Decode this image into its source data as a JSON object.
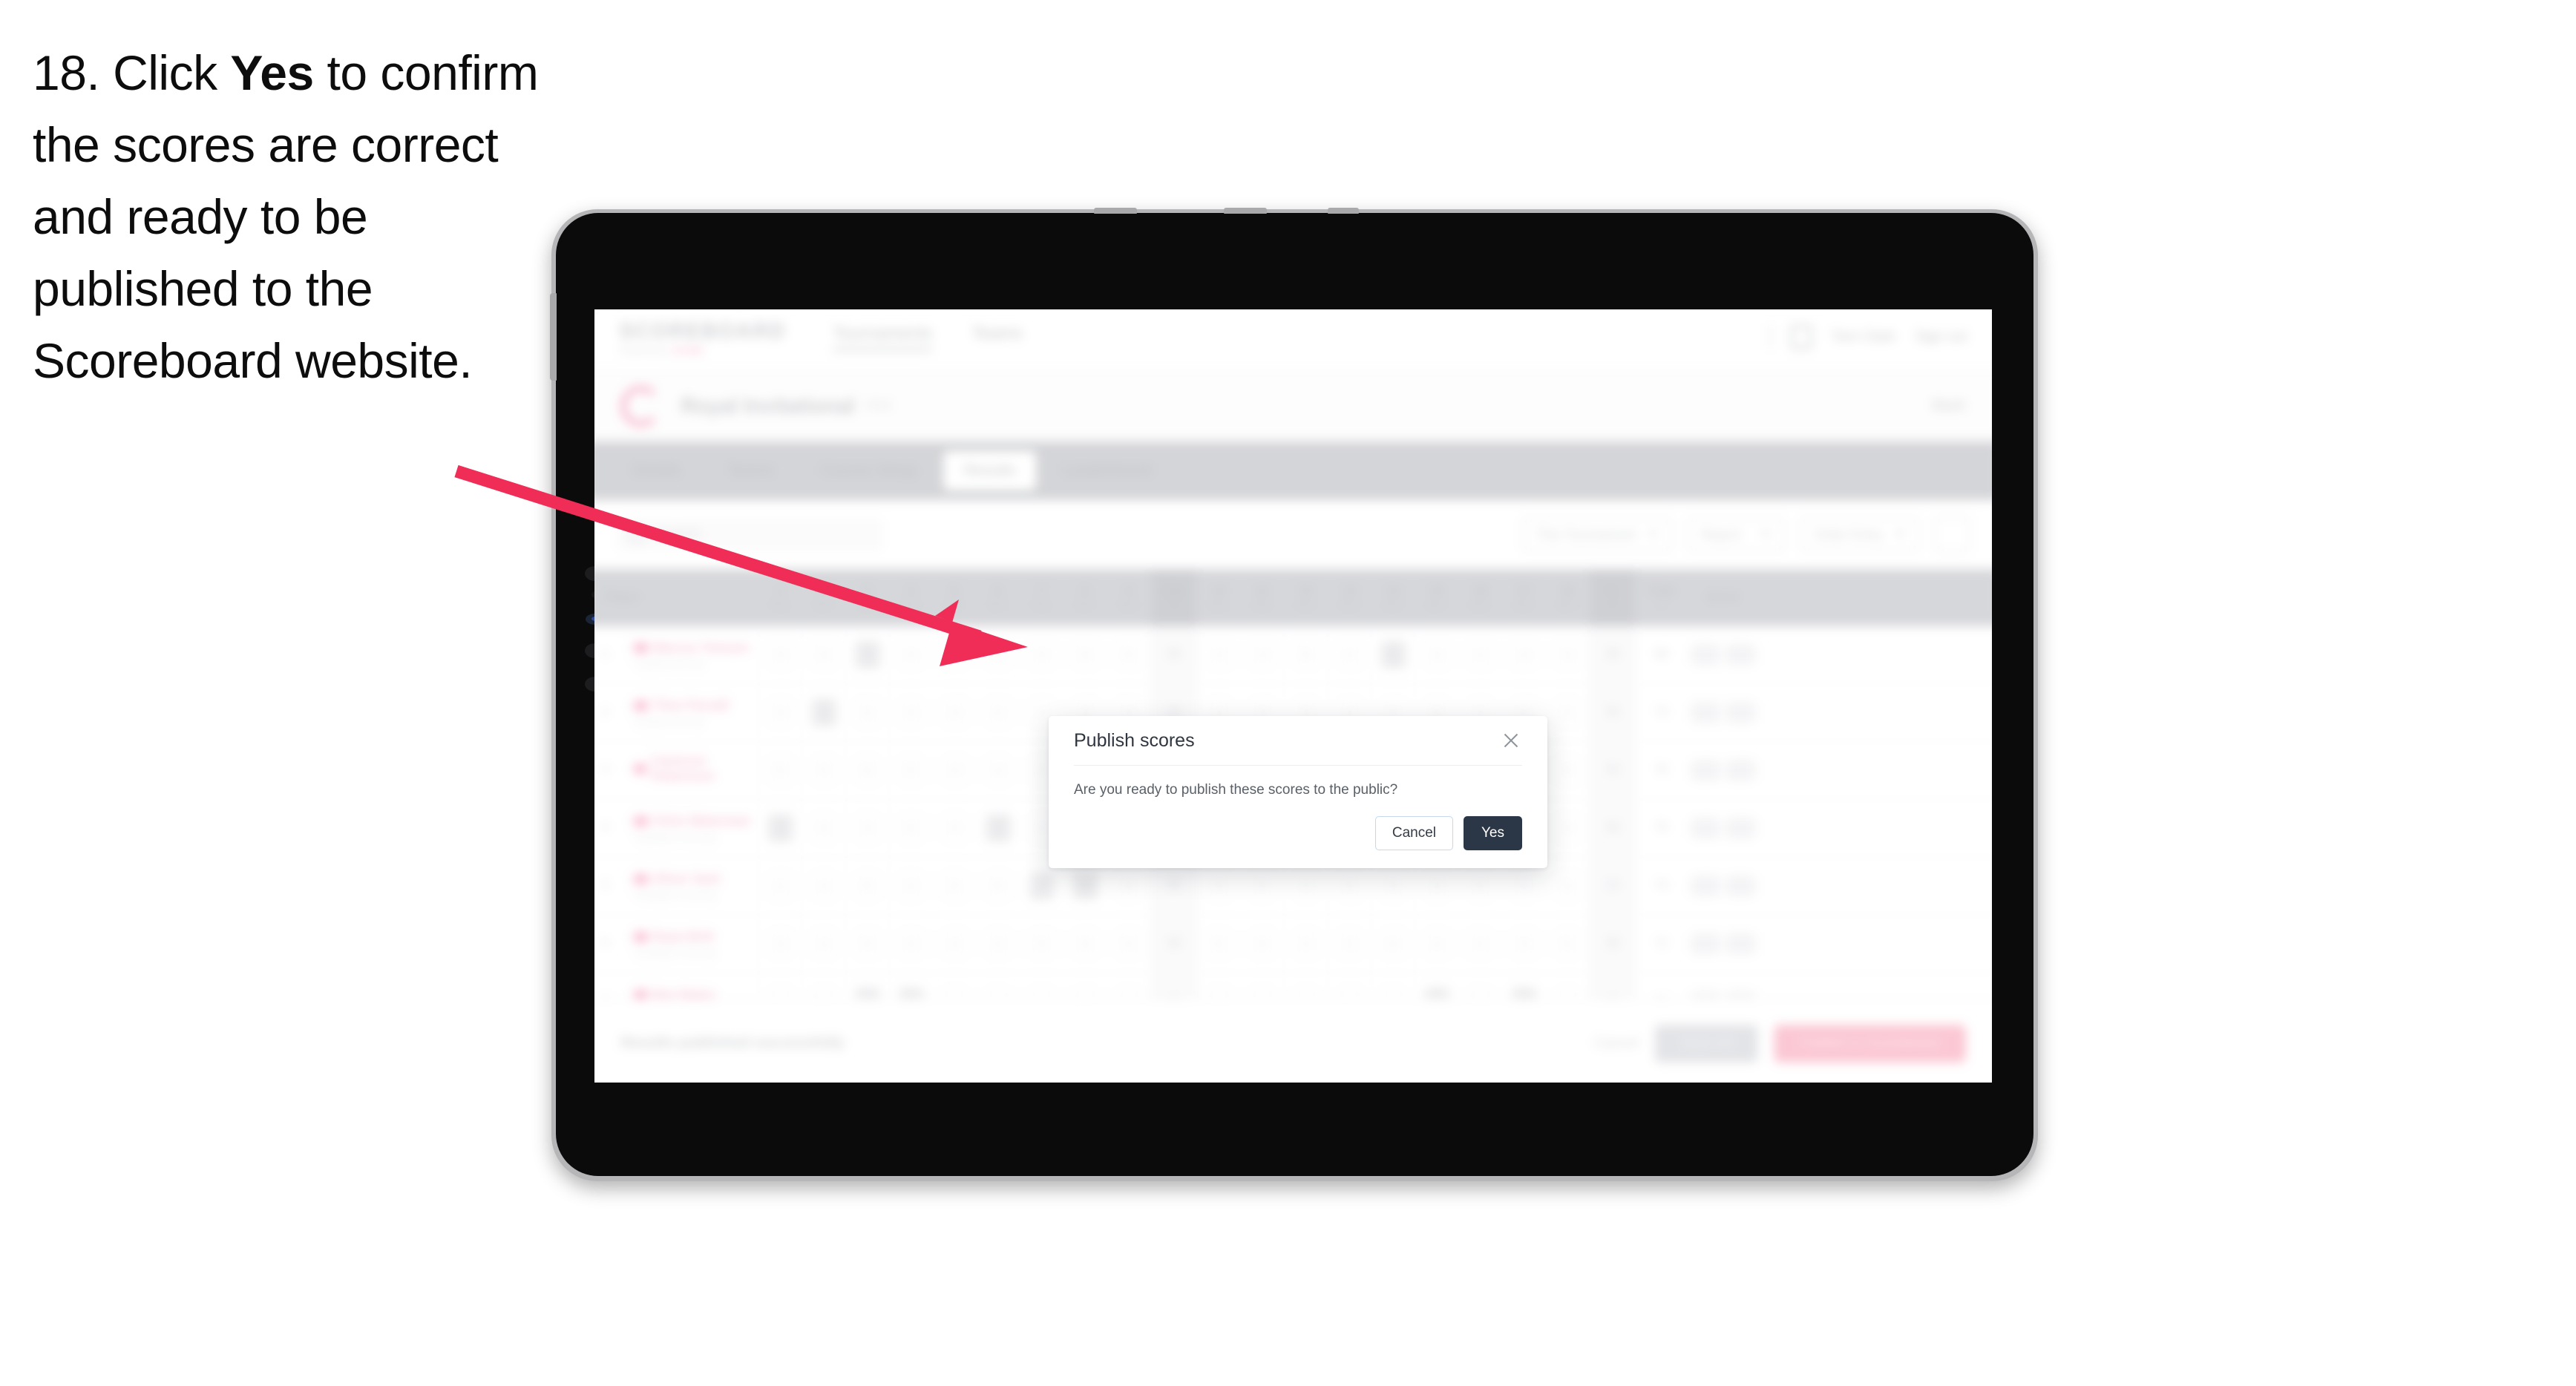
{
  "caption": {
    "step_number": "18.",
    "text_before": " Click ",
    "bold_word": "Yes",
    "text_after": " to confirm the scores are correct and ready to be published to the Scoreboard website."
  },
  "annotation": {
    "arrow_color": "#ef2d56",
    "arrow_name": "pointer-arrow-to-yes-button"
  },
  "device": {
    "type": "tablet",
    "body_color": "#0b0b0b",
    "frame_color": "#b6b6b8"
  },
  "app": {
    "nav": {
      "brand_title": "SCOREBOARD",
      "brand_sub_prefix": "Powered by",
      "brand_sub_pink": "SCORE",
      "links": [
        {
          "label": "Tournaments",
          "active": true
        },
        {
          "label": "Teams",
          "active": false
        }
      ],
      "user_name": "Tom Clark",
      "sign_out": "Sign out"
    },
    "event": {
      "name": "Royal Invitational",
      "year": "2024",
      "back_label": "Back"
    },
    "tabs": [
      {
        "label": "Details",
        "active": false
      },
      {
        "label": "Teams",
        "active": false
      },
      {
        "label": "Course Setup",
        "active": false
      },
      {
        "label": "Results",
        "active": true
      },
      {
        "label": "Leaderboard",
        "active": false
      }
    ],
    "filters": {
      "search_placeholder": "Search",
      "round_select": "This Tournament",
      "report_select": "Report",
      "order_select": "Order Entry",
      "grid_icon": "grid-icon"
    },
    "table": {
      "columns": [
        {
          "t1": "Player",
          "t2": "",
          "kind": "player"
        },
        {
          "t1": "1",
          "t2": "Par 4",
          "kind": "hole"
        },
        {
          "t1": "2",
          "t2": "Par 4",
          "kind": "hole"
        },
        {
          "t1": "3",
          "t2": "Par 3",
          "kind": "hole"
        },
        {
          "t1": "4",
          "t2": "Par 5",
          "kind": "hole"
        },
        {
          "t1": "5",
          "t2": "Par 4",
          "kind": "hole"
        },
        {
          "t1": "6",
          "t2": "Par 4",
          "kind": "hole"
        },
        {
          "t1": "7",
          "t2": "Par 3",
          "kind": "hole"
        },
        {
          "t1": "8",
          "t2": "Par 4",
          "kind": "hole"
        },
        {
          "t1": "9",
          "t2": "Par 5",
          "kind": "hole"
        },
        {
          "t1": "Out",
          "t2": "36",
          "kind": "out"
        },
        {
          "t1": "10",
          "t2": "Par 4",
          "kind": "hole"
        },
        {
          "t1": "11",
          "t2": "Par 4",
          "kind": "hole"
        },
        {
          "t1": "12",
          "t2": "Par 3",
          "kind": "hole"
        },
        {
          "t1": "13",
          "t2": "Par 5",
          "kind": "hole"
        },
        {
          "t1": "14",
          "t2": "Par 4",
          "kind": "hole"
        },
        {
          "t1": "15",
          "t2": "Par 4",
          "kind": "hole"
        },
        {
          "t1": "16",
          "t2": "Par 3",
          "kind": "hole"
        },
        {
          "t1": "17",
          "t2": "Par 4",
          "kind": "hole"
        },
        {
          "t1": "18",
          "t2": "Par 5",
          "kind": "hole"
        },
        {
          "t1": "In",
          "t2": "36",
          "kind": "in"
        },
        {
          "t1": "Total",
          "t2": "72",
          "kind": "tot"
        },
        {
          "t1": "Score",
          "t2": "",
          "kind": "score"
        }
      ],
      "rows": [
        {
          "pos": "1",
          "name": "Marcus Tomsen",
          "club": "Coastal Golf Club"
        },
        {
          "pos": "2",
          "name": "Theo Parsall",
          "club": "Coastal Golf Club"
        },
        {
          "pos": "3",
          "name": "Cameron Robertson",
          "club": ""
        },
        {
          "pos": "4",
          "name": "Chris Waterman",
          "club": "Southpark University"
        },
        {
          "pos": "5",
          "name": "Oliver Sant",
          "club": "Southpark University"
        },
        {
          "pos": "6",
          "name": "Ryan Britt",
          "club": "Southpark University"
        },
        {
          "pos": "7",
          "name": "Ben Bates",
          "club": "Southpark University"
        }
      ]
    },
    "bottom_bar": {
      "note": "Results published successfully",
      "cancel": "Cancel",
      "save": "Save All",
      "publish": "Publish to Scoreboard"
    }
  },
  "modal": {
    "title": "Publish scores",
    "message": "Are you ready to publish these scores to the public?",
    "cancel_label": "Cancel",
    "confirm_label": "Yes",
    "close_icon": "close-icon",
    "confirm_color": "#2b3746"
  }
}
